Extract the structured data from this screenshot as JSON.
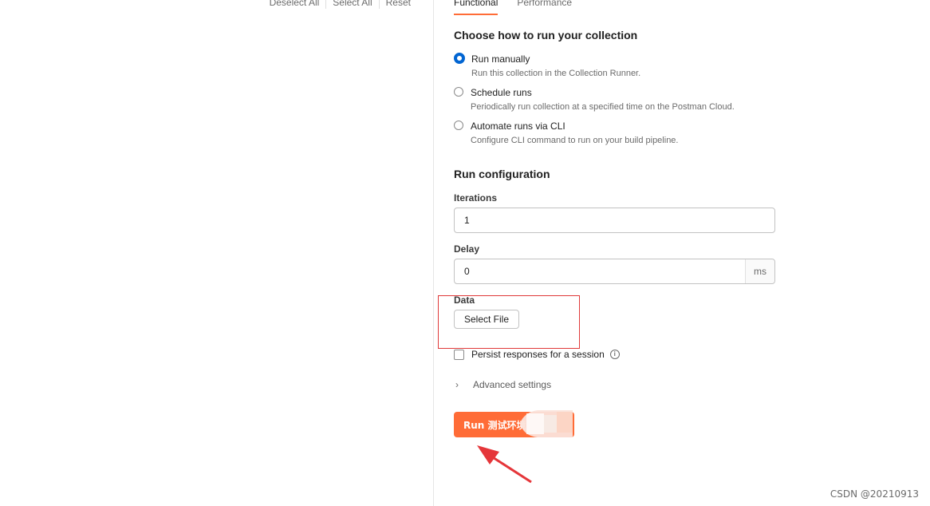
{
  "left_panel": {
    "actions": [
      "Deselect All",
      "Select All",
      "Reset"
    ]
  },
  "tabs": [
    {
      "label": "Functional",
      "active": true
    },
    {
      "label": "Performance",
      "active": false
    }
  ],
  "run_mode": {
    "title": "Choose how to run your collection",
    "selected": "Run manually",
    "options": [
      {
        "label": "Run manually",
        "desc": "Run this collection in the Collection Runner."
      },
      {
        "label": "Schedule runs",
        "desc": "Periodically run collection at a specified time on the Postman Cloud."
      },
      {
        "label": "Automate runs via CLI",
        "desc": "Configure CLI command to run on your build pipeline."
      }
    ]
  },
  "run_config": {
    "title": "Run configuration",
    "iterations_label": "Iterations",
    "iterations_value": "1",
    "delay_label": "Delay",
    "delay_value": "0",
    "delay_unit": "ms",
    "data_label": "Data",
    "select_file_label": "Select File",
    "persist_label": "Persist responses for a session",
    "persist_checked": false,
    "info_icon": "info-icon",
    "advanced_label": "Advanced settings",
    "run_button_label": "Run 测试环境"
  },
  "colors": {
    "accent": "#ff6c37",
    "radio_selected": "#0265d2",
    "annotation": "#e03a3a"
  },
  "watermark": "CSDN @20210913"
}
